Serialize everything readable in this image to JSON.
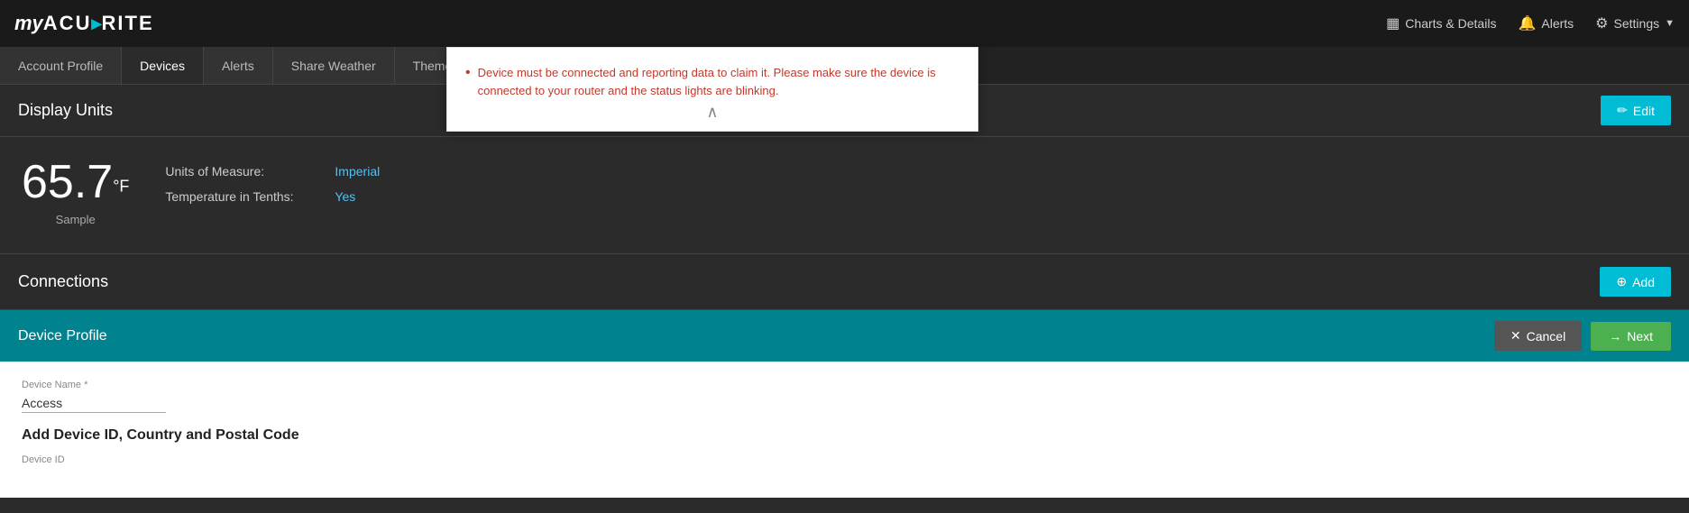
{
  "app": {
    "logo_my": "my",
    "logo_acu": "ACU",
    "logo_dot": "▸",
    "logo_rite": "RITE"
  },
  "nav": {
    "charts_icon": "▦",
    "charts_label": "Charts & Details",
    "alerts_icon": "🔔",
    "alerts_label": "Alerts",
    "settings_icon": "⚙",
    "settings_label": "Settings"
  },
  "tabs": [
    {
      "id": "account-profile",
      "label": "Account Profile",
      "active": false
    },
    {
      "id": "devices",
      "label": "Devices",
      "active": true
    },
    {
      "id": "alerts",
      "label": "Alerts",
      "active": false
    },
    {
      "id": "share-weather",
      "label": "Share Weather",
      "active": false
    },
    {
      "id": "theme-options",
      "label": "Theme Options",
      "active": false
    }
  ],
  "display_units": {
    "section_title": "Display Units",
    "edit_label": "Edit",
    "edit_icon": "✏",
    "temperature": "65.7",
    "temp_unit": "°F",
    "temp_sample": "Sample",
    "units_of_measure_label": "Units of Measure:",
    "units_of_measure_value": "Imperial",
    "temperature_in_tenths_label": "Temperature in Tenths:",
    "temperature_in_tenths_value": "Yes"
  },
  "connections": {
    "section_title": "Connections",
    "add_label": "Add",
    "add_icon": "⊕"
  },
  "device_profile": {
    "header_title": "Device Profile",
    "cancel_label": "Cancel",
    "cancel_icon": "✕",
    "next_label": "Next",
    "next_icon": "→",
    "device_name_label": "Device Name *",
    "device_name_value": "Access",
    "add_device_title": "Add Device ID, Country and Postal Code",
    "device_id_label": "Device ID"
  },
  "popup": {
    "bullet": "•",
    "message": "Device must be connected and reporting data to claim it. Please make sure the device is connected to your router and the status lights are blinking.",
    "arrow": "∧"
  }
}
